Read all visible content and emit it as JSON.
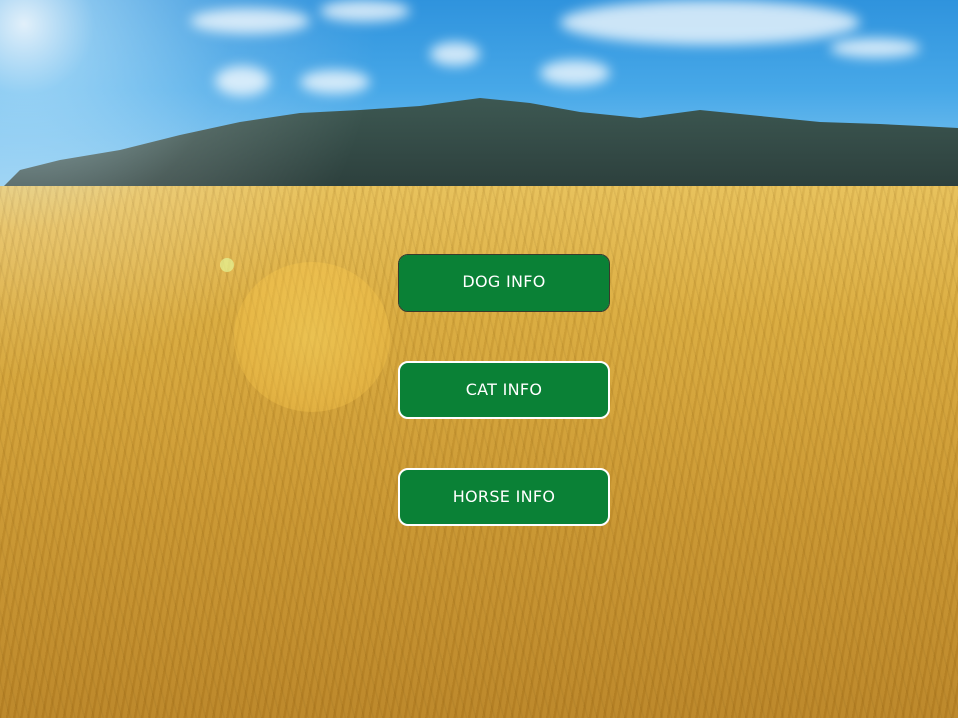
{
  "menu": {
    "buttons": [
      {
        "label": "DOG INFO",
        "focused": true
      },
      {
        "label": "CAT INFO",
        "focused": false
      },
      {
        "label": "HORSE INFO",
        "focused": false
      }
    ]
  },
  "colors": {
    "button_bg": "#0a8136",
    "button_text": "#ffffff",
    "sky": "#2f93dd",
    "field": "#d9aa3e"
  }
}
